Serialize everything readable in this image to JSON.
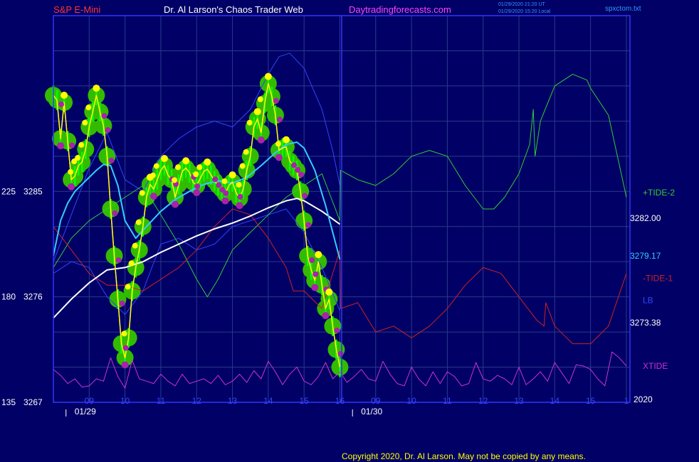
{
  "header": {
    "symbol": "S&P E-Mini",
    "title": "Dr. Al Larson's Chaos Trader Web",
    "site": "Daytradingforecasts.com",
    "stamp_line1": "01/29/2020 21:20 UT",
    "stamp_line2": "01/29/2020 15:20 Local",
    "file": "spxctom.txt"
  },
  "footer": {
    "copyright": "Copyright 2020, Dr. Al Larson. May not be copied by any means."
  },
  "colors": {
    "background": "#000066",
    "frame": "#3333ff",
    "grid": "#2a3a8c",
    "price": "#ffff00",
    "tide2": "#33cc33",
    "tide1": "#cc2222",
    "xtide": "#cc33cc",
    "lb": "#3344ff",
    "white_ma": "#ffffff",
    "cyan_ma": "#33ccff",
    "bubble": "#33bb00",
    "bubble_hi": "#00ff00",
    "dot_high": "#ffff00",
    "dot_low": "#aa22aa"
  },
  "chart_data": {
    "type": "line",
    "ylim": [
      3267,
      3300
    ],
    "left_labels": [
      {
        "alt": "225",
        "price": "3285",
        "value": 3285
      },
      {
        "alt": "180",
        "price": "3276",
        "value": 3276
      },
      {
        "alt": "135",
        "price": "3267",
        "value": 3267
      }
    ],
    "x_ticks": [
      "09",
      "10",
      "11",
      "12",
      "13",
      "14",
      "15",
      "16",
      "09",
      "10",
      "11",
      "12",
      "13",
      "14",
      "15",
      "1"
    ],
    "x_tick_pos": [
      9,
      10,
      11,
      12,
      13,
      14,
      15,
      16,
      17,
      18,
      19,
      20,
      21,
      22,
      23,
      24
    ],
    "x_range": [
      8.0,
      24.1
    ],
    "date_labels": [
      {
        "text": "01/29",
        "x": 8.75
      },
      {
        "text": "01/30",
        "x": 16.75
      }
    ],
    "end_year": "2020",
    "right_labels": [
      {
        "text": "+TIDE-2",
        "color": "#33cc33",
        "value": 3284.9
      },
      {
        "text": "3282.00",
        "color": "#ffffff",
        "value": 3282.7
      },
      {
        "text": "3279.17",
        "color": "#33ccff",
        "value": 3279.5
      },
      {
        "text": "-TIDE-1",
        "color": "#cc2222",
        "value": 3277.6
      },
      {
        "text": "LB",
        "color": "#3344ff",
        "value": 3275.7
      },
      {
        "text": "3273.38",
        "color": "#ffffff",
        "value": 3273.8
      },
      {
        "text": "XTIDE",
        "color": "#cc33cc",
        "value": 3270.1
      }
    ],
    "series": [
      {
        "key": "price",
        "x": [
          8.0,
          8.1,
          8.2,
          8.3,
          8.4,
          8.5,
          8.6,
          8.7,
          8.8,
          8.9,
          9.0,
          9.1,
          9.2,
          9.3,
          9.4,
          9.5,
          9.6,
          9.7,
          9.8,
          9.9,
          10.0,
          10.1,
          10.2,
          10.3,
          10.4,
          10.5,
          10.6,
          10.7,
          10.8,
          10.9,
          11.0,
          11.1,
          11.2,
          11.3,
          11.4,
          11.5,
          11.6,
          11.7,
          11.8,
          11.9,
          12.0,
          12.1,
          12.2,
          12.3,
          12.4,
          12.5,
          12.6,
          12.7,
          12.8,
          12.9,
          13.0,
          13.1,
          13.2,
          13.3,
          13.4,
          13.5,
          13.6,
          13.7,
          13.8,
          13.9,
          14.0,
          14.1,
          14.2,
          14.3,
          14.4,
          14.5,
          14.6,
          14.7,
          14.8,
          14.9,
          15.0,
          15.1,
          15.2,
          15.3,
          15.4,
          15.5,
          15.6,
          15.7,
          15.8,
          15.9,
          16.0
        ],
        "values": [
          3293.2,
          3292.8,
          3289.5,
          3292.6,
          3289.3,
          3286.0,
          3286.3,
          3287.2,
          3287.5,
          3288.6,
          3290.5,
          3291.8,
          3293.2,
          3291.8,
          3290.6,
          3288.0,
          3283.5,
          3279.5,
          3275.8,
          3272.0,
          3270.8,
          3272.5,
          3276.5,
          3278.5,
          3280.0,
          3282.0,
          3284.5,
          3285.6,
          3285.2,
          3286.0,
          3286.8,
          3287.2,
          3286.4,
          3286.0,
          3284.5,
          3285.6,
          3286.7,
          3287.0,
          3286.6,
          3285.8,
          3285.5,
          3286.1,
          3286.7,
          3286.9,
          3286.4,
          3285.9,
          3285.5,
          3285.2,
          3284.8,
          3285.5,
          3285.8,
          3284.9,
          3284.4,
          3285.2,
          3286.8,
          3288.0,
          3290.5,
          3291.2,
          3290.0,
          3292.5,
          3294.2,
          3293.1,
          3291.5,
          3288.5,
          3288.7,
          3288.8,
          3287.6,
          3287.2,
          3286.8,
          3285.0,
          3282.5,
          3279.5,
          3278.3,
          3277.4,
          3279.0,
          3277.0,
          3275.0,
          3275.8,
          3273.5,
          3271.5,
          3270.0
        ]
      },
      {
        "key": "tide2",
        "x": [
          8.0,
          8.5,
          9.0,
          9.5,
          10.0,
          10.5,
          11.0,
          11.5,
          12.0,
          12.3,
          12.6,
          13.0,
          13.5,
          14.0,
          14.5,
          15.0,
          15.5,
          16.0,
          16.02,
          16.5,
          17.0,
          17.5,
          18.0,
          18.5,
          19.0,
          19.5,
          20.0,
          20.3,
          20.6,
          21.0,
          21.3,
          21.4,
          21.45,
          21.6,
          22.0,
          22.5,
          22.9,
          23.0,
          23.5,
          24.0
        ],
        "values": [
          3278.5,
          3281.0,
          3282.5,
          3283.5,
          3284.5,
          3285.5,
          3283.0,
          3280.5,
          3277.5,
          3276.0,
          3277.5,
          3280.0,
          3281.5,
          3283.0,
          3284.5,
          3285.5,
          3286.5,
          3282.5,
          3286.8,
          3286.0,
          3285.5,
          3286.5,
          3288.0,
          3288.5,
          3288.0,
          3285.5,
          3283.5,
          3283.5,
          3284.5,
          3286.5,
          3289.0,
          3292.0,
          3288.0,
          3291.0,
          3294.0,
          3295.0,
          3294.5,
          3293.8,
          3291.5,
          3284.5
        ]
      },
      {
        "key": "tide1",
        "x": [
          8.0,
          8.5,
          9.0,
          9.5,
          10.0,
          10.5,
          11.0,
          11.5,
          12.0,
          12.5,
          13.0,
          13.5,
          14.0,
          14.5,
          14.7,
          15.0,
          15.5,
          16.0,
          16.02,
          16.5,
          17.0,
          17.5,
          18.0,
          18.5,
          19.0,
          19.5,
          20.0,
          20.5,
          21.0,
          21.5,
          21.7,
          21.75,
          22.0,
          22.5,
          23.0,
          23.5,
          24.0
        ],
        "values": [
          3282.0,
          3280.0,
          3278.0,
          3277.0,
          3277.0,
          3276.5,
          3277.5,
          3278.5,
          3280.0,
          3282.0,
          3283.5,
          3283.0,
          3281.0,
          3278.5,
          3276.5,
          3276.5,
          3275.0,
          3280.0,
          3275.0,
          3275.5,
          3273.0,
          3273.5,
          3272.5,
          3273.5,
          3275.0,
          3277.0,
          3278.5,
          3278.0,
          3276.0,
          3274.0,
          3273.5,
          3275.5,
          3273.5,
          3272.0,
          3272.0,
          3273.5,
          3278.0
        ]
      },
      {
        "key": "lb_upper",
        "x": [
          8.0,
          8.5,
          9.0,
          9.5,
          10.0,
          10.5,
          11.0,
          11.5,
          12.0,
          12.5,
          13.0,
          13.5,
          14.0,
          14.3,
          14.6,
          15.0,
          15.5,
          15.8,
          16.0
        ],
        "values": [
          3279.0,
          3283.0,
          3287.0,
          3290.0,
          3286.0,
          3285.0,
          3288.0,
          3289.5,
          3290.5,
          3291.0,
          3290.5,
          3292.0,
          3295.0,
          3296.5,
          3296.8,
          3295.5,
          3292.0,
          3288.5,
          3285.5
        ]
      },
      {
        "key": "lb_lower",
        "x": [
          8.0,
          8.5,
          9.0,
          9.5,
          10.0,
          10.5,
          11.0,
          11.5,
          12.0,
          12.5,
          13.0,
          13.5,
          14.0,
          14.5,
          15.0,
          15.5,
          16.0
        ],
        "values": [
          3278.0,
          3279.0,
          3278.5,
          3276.0,
          3274.5,
          3276.5,
          3280.5,
          3281.0,
          3280.0,
          3280.5,
          3282.0,
          3282.5,
          3283.0,
          3283.5,
          3281.5,
          3278.5,
          3274.8
        ]
      },
      {
        "key": "white_ma",
        "x": [
          8.0,
          8.5,
          9.0,
          9.5,
          10.0,
          10.5,
          11.0,
          11.5,
          12.0,
          12.5,
          13.0,
          13.5,
          14.0,
          14.5,
          14.8,
          15.0,
          15.5,
          16.0
        ],
        "values": [
          3274.2,
          3275.8,
          3277.2,
          3278.3,
          3278.5,
          3279.0,
          3279.8,
          3280.5,
          3281.2,
          3281.8,
          3282.3,
          3282.9,
          3283.6,
          3284.2,
          3284.4,
          3284.2,
          3283.3,
          3282.2
        ]
      },
      {
        "key": "cyan_ma",
        "x": [
          8.0,
          8.2,
          8.4,
          8.6,
          8.8,
          9.0,
          9.2,
          9.4,
          9.6,
          9.8,
          10.0,
          10.3,
          10.6,
          11.0,
          11.4,
          11.8,
          12.2,
          12.6,
          13.0,
          13.4,
          13.8,
          14.2,
          14.5,
          14.8,
          15.0,
          15.3,
          15.6,
          16.0
        ],
        "values": [
          3279.5,
          3282.5,
          3284.0,
          3285.0,
          3285.6,
          3286.2,
          3286.8,
          3287.3,
          3287.2,
          3285.5,
          3282.5,
          3281.0,
          3282.0,
          3283.3,
          3284.3,
          3285.0,
          3285.6,
          3285.9,
          3285.7,
          3286.2,
          3287.2,
          3288.3,
          3289.0,
          3289.2,
          3288.7,
          3286.8,
          3283.8,
          3279.2
        ]
      },
      {
        "key": "xtide",
        "x": [
          8.0,
          8.2,
          8.4,
          8.6,
          8.8,
          9.0,
          9.2,
          9.4,
          9.6,
          9.8,
          10.0,
          10.2,
          10.4,
          10.6,
          10.8,
          11.0,
          11.2,
          11.4,
          11.6,
          11.8,
          12.0,
          12.2,
          12.4,
          12.6,
          12.8,
          13.0,
          13.2,
          13.4,
          13.6,
          13.8,
          14.0,
          14.2,
          14.4,
          14.6,
          14.8,
          15.0,
          15.2,
          15.4,
          15.6,
          15.8,
          16.0,
          16.2,
          16.4,
          16.6,
          16.8,
          17.0,
          17.2,
          17.4,
          17.6,
          17.8,
          18.0,
          18.2,
          18.4,
          18.6,
          18.8,
          19.0,
          19.2,
          19.4,
          19.6,
          19.8,
          20.0,
          20.2,
          20.4,
          20.6,
          20.8,
          21.0,
          21.2,
          21.4,
          21.6,
          21.8,
          22.0,
          22.2,
          22.4,
          22.6,
          22.8,
          23.0,
          23.2,
          23.4,
          23.6,
          23.8,
          24.0
        ],
        "values": [
          3269.8,
          3269.3,
          3268.6,
          3269.0,
          3268.3,
          3268.4,
          3269.0,
          3268.8,
          3270.8,
          3269.2,
          3268.2,
          3270.6,
          3269.0,
          3268.8,
          3268.6,
          3269.4,
          3268.8,
          3268.4,
          3269.4,
          3268.6,
          3268.8,
          3269.0,
          3268.6,
          3269.3,
          3268.5,
          3268.8,
          3269.4,
          3268.7,
          3269.7,
          3269.0,
          3270.5,
          3269.6,
          3268.5,
          3269.4,
          3270.0,
          3268.8,
          3268.5,
          3269.2,
          3270.4,
          3269.0,
          3269.6,
          3268.7,
          3269.2,
          3269.8,
          3269.0,
          3268.8,
          3270.5,
          3269.4,
          3268.6,
          3268.4,
          3270.0,
          3269.0,
          3268.4,
          3269.6,
          3268.6,
          3269.6,
          3269.2,
          3268.4,
          3268.6,
          3270.4,
          3269.0,
          3268.8,
          3269.3,
          3269.0,
          3268.5,
          3270.0,
          3268.5,
          3269.0,
          3269.6,
          3268.8,
          3270.4,
          3269.5,
          3268.6,
          3270.2,
          3270.1,
          3269.8,
          3269.0,
          3268.4,
          3271.3,
          3270.8,
          3270.1
        ]
      }
    ]
  }
}
